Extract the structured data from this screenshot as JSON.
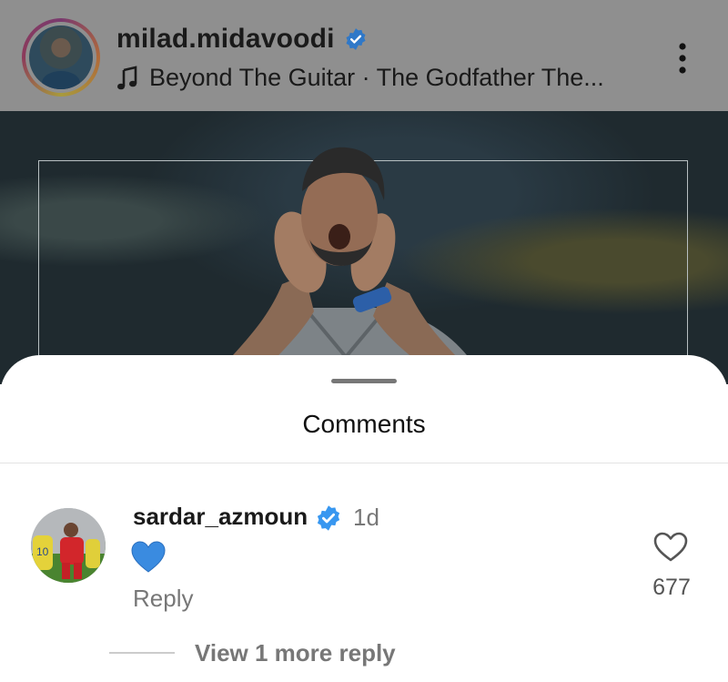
{
  "post": {
    "username": "milad.midavoodi",
    "music": "Beyond The Guitar · The Godfather The..."
  },
  "sheet": {
    "title": "Comments"
  },
  "comment": {
    "username": "sardar_azmoun",
    "time": "1d",
    "text_emoji": "blue-heart-emoji",
    "reply_label": "Reply",
    "like_count": "677"
  },
  "view_more_replies": "View 1 more reply",
  "colors": {
    "verified": "#3897f0",
    "blue_heart": "#3a8be0"
  }
}
